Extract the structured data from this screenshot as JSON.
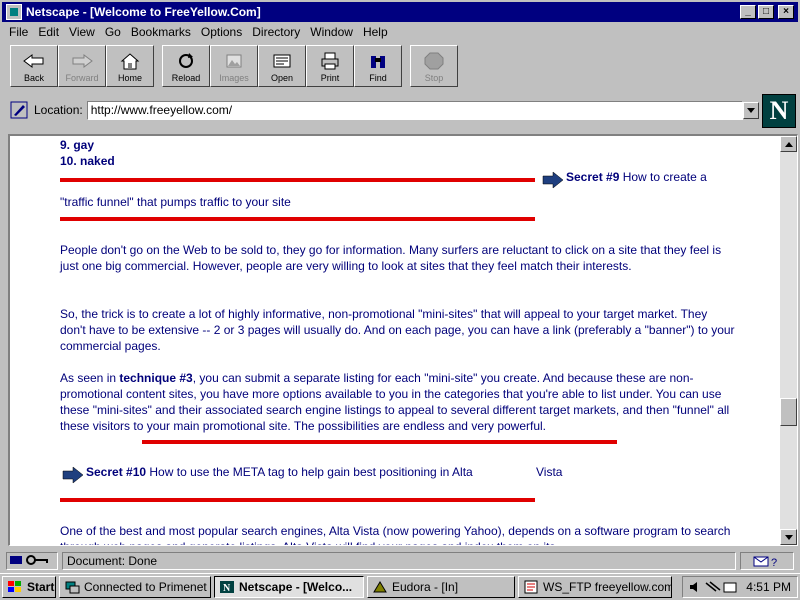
{
  "window": {
    "title": "Netscape - [Welcome to FreeYellow.Com]",
    "controls": {
      "minimize": "_",
      "maximize": "□",
      "close": "×"
    }
  },
  "menu": [
    {
      "label": "File"
    },
    {
      "label": "Edit"
    },
    {
      "label": "View"
    },
    {
      "label": "Go"
    },
    {
      "label": "Bookmarks"
    },
    {
      "label": "Options"
    },
    {
      "label": "Directory"
    },
    {
      "label": "Window"
    },
    {
      "label": "Help"
    }
  ],
  "toolbar": {
    "back": "Back",
    "forward": "Forward",
    "home": "Home",
    "reload": "Reload",
    "images": "Images",
    "open": "Open",
    "print": "Print",
    "find": "Find",
    "stop": "Stop"
  },
  "location": {
    "label": "Location:",
    "url": "http://www.freeyellow.com/"
  },
  "logo": {
    "letter": "N"
  },
  "content": {
    "list_item_9": "9. gay",
    "list_item_10": "10. naked",
    "secret9_label": "Secret #9",
    "secret9_title_a": "How to create a",
    "secret9_title_b": "\"traffic funnel\" that pumps traffic to your site",
    "para1": "People don't go on the Web to be sold to, they go for information. Many surfers are reluctant to click on a site that they feel is just one big commercial. However, people are very willing to look at sites that they feel match their interests.",
    "para2": "So, the trick is to create a lot of highly informative, non-promotional \"mini-sites\" that will appeal to your target market. They don't have to be extensive -- 2 or 3 pages will usually do. And on each page, you can have a link (preferably a \"banner\") to your commercial pages.",
    "para3_pre": "As seen in ",
    "para3_bold": "technique #3",
    "para3_post": ", you can submit a separate listing for each \"mini-site\" you create. And because these are non-promotional content sites, you have more options available to you in the categories that you're able to list under. You can use these \"mini-sites\" and their associated search engine listings to appeal to several different target markets, and then \"funnel\" all these visitors to your main promotional site. The possibilities are endless and very powerful.",
    "secret10_label": "Secret #10",
    "secret10_title": "How to use the META tag to help gain best positioning in Alta",
    "secret10_title_b": "Vista",
    "para4": "One of the best and most popular search engines, Alta Vista (now powering Yahoo), depends on a software program to search through web pages and generate listings. Alta Vista will find your pages and index them on its"
  },
  "status": {
    "text": "Document: Done"
  },
  "taskbar": {
    "start": "Start",
    "tasks": [
      {
        "label": "Connected to Primenet"
      },
      {
        "label": "Netscape - [Welco..."
      },
      {
        "label": "Eudora - [In]"
      },
      {
        "label": "WS_FTP freeyellow.com"
      }
    ],
    "clock": "4:51 PM"
  },
  "colors": {
    "title_bar": "#000080",
    "link_text": "#00007a",
    "rule": "#e00000",
    "face": "#c0c0c0"
  }
}
